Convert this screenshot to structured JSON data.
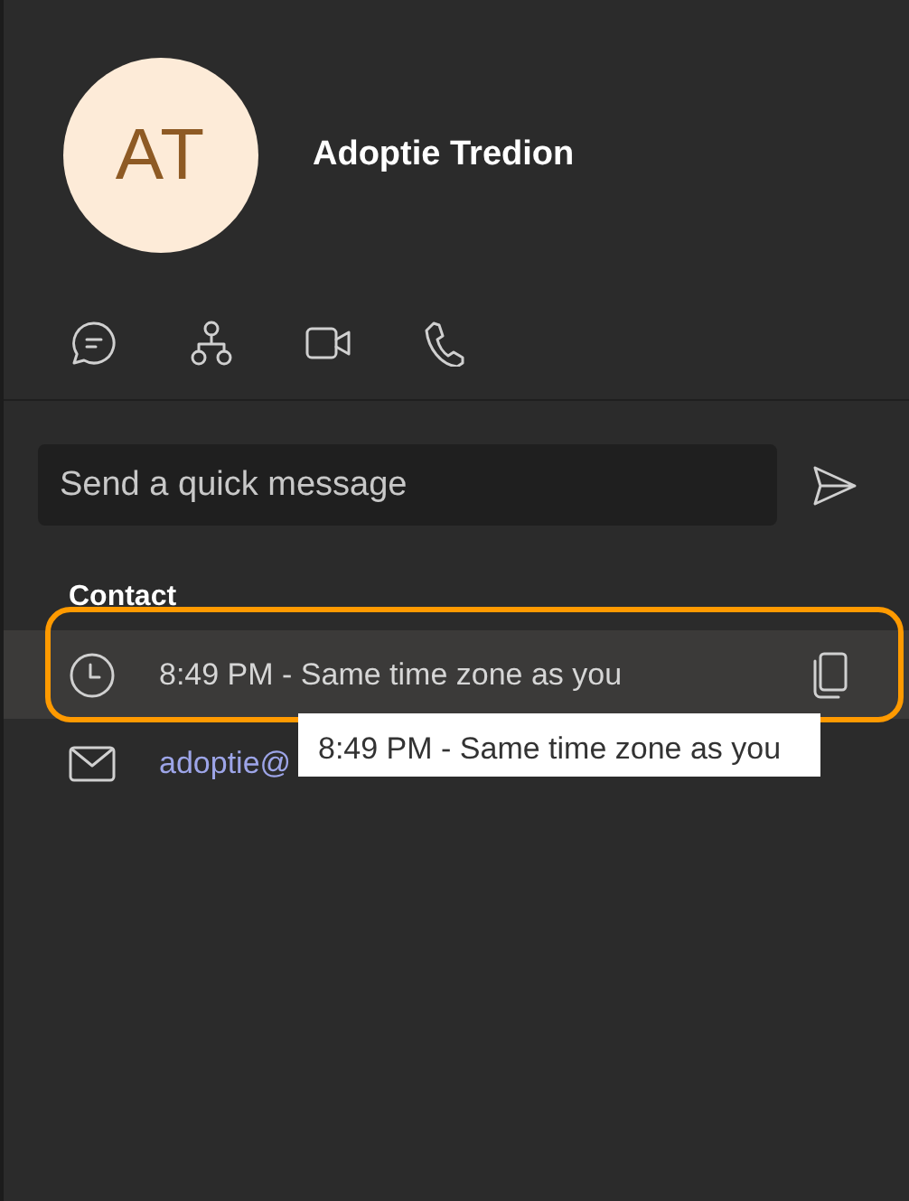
{
  "profile": {
    "initials": "AT",
    "name": "Adoptie Tredion"
  },
  "actions": [
    {
      "kind": "chat"
    },
    {
      "kind": "org"
    },
    {
      "kind": "video"
    },
    {
      "kind": "call"
    }
  ],
  "quick_message": {
    "placeholder": "Send a quick message"
  },
  "contact": {
    "heading": "Contact",
    "items": [
      {
        "kind": "time",
        "text": "8:49 PM - Same time zone as you",
        "hovered": true,
        "highlighted": true
      },
      {
        "kind": "email",
        "text": "adoptie@",
        "hovered": false,
        "highlighted": false
      }
    ]
  },
  "tooltip": {
    "text": "8:49 PM - Same time zone as you"
  }
}
